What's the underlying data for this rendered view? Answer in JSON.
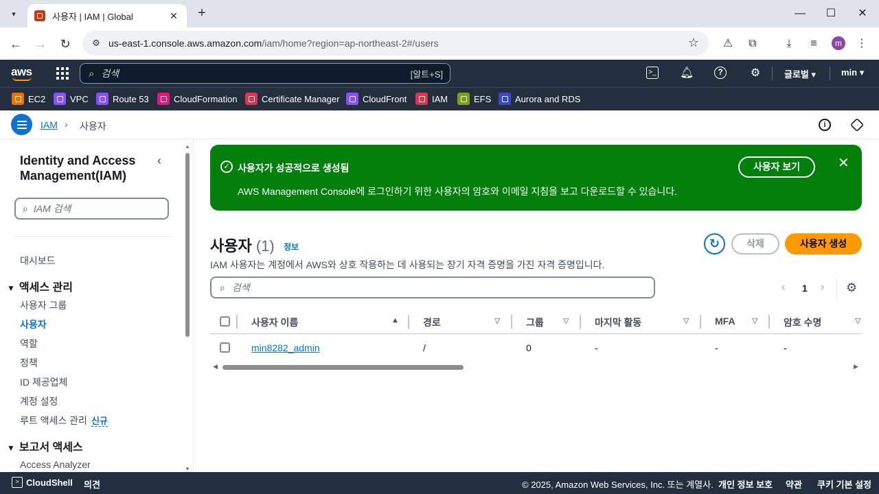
{
  "browser": {
    "tab_title": "사용자 | IAM | Global",
    "url_host": "us-east-1.console.aws.amazon.com",
    "url_path": "/iam/home?region=ap-northeast-2#/users",
    "profile_initial": "m"
  },
  "aws_nav": {
    "logo": "aws",
    "search_placeholder": "검색",
    "search_shortcut": "[알트+S]",
    "region": "글로벌 ▾",
    "user": "min ▾"
  },
  "favorites": [
    {
      "label": "EC2",
      "color": "#ed7100"
    },
    {
      "label": "VPC",
      "color": "#8c4fff"
    },
    {
      "label": "Route 53",
      "color": "#8c4fff"
    },
    {
      "label": "CloudFormation",
      "color": "#e7157b"
    },
    {
      "label": "Certificate Manager",
      "color": "#dd344c"
    },
    {
      "label": "CloudFront",
      "color": "#8c4fff"
    },
    {
      "label": "IAM",
      "color": "#dd344c"
    },
    {
      "label": "EFS",
      "color": "#7aa116"
    },
    {
      "label": "Aurora and RDS",
      "color": "#3b48cc"
    }
  ],
  "breadcrumb": {
    "root": "IAM",
    "current": "사용자"
  },
  "sidebar": {
    "title": "Identity and Access Management(IAM)",
    "search_placeholder": "IAM 검색",
    "dashboard": "대시보드",
    "section_access": "액세스 관리",
    "items": [
      "사용자 그룹",
      "사용자",
      "역할",
      "정책",
      "ID 제공업체",
      "계정 설정",
      "루트 액세스 관리"
    ],
    "new_badge": "신규",
    "section_reports": "보고서 액세스",
    "report_items": [
      "Access Analyzer"
    ]
  },
  "flash": {
    "title": "사용자가 성공적으로 생성됨",
    "message": "AWS Management Console에 로그인하기 위한 사용자의 암호와 이메일 지침을 보고 다운로드할 수 있습니다.",
    "button": "사용자 보기"
  },
  "header": {
    "title": "사용자",
    "count": "(1)",
    "info": "정보",
    "description": "IAM 사용자는 계정에서 AWS와 상호 작용하는 데 사용되는 장기 자격 증명을 가진 자격 증명입니다.",
    "delete": "삭제",
    "create": "사용자 생성"
  },
  "table": {
    "search_placeholder": "검색",
    "page": "1",
    "columns": [
      "사용자 이름",
      "경로",
      "그룹",
      "마지막 활동",
      "MFA",
      "암호 수명"
    ],
    "rows": [
      {
        "name": "min8282_admin",
        "path": "/",
        "groups": "0",
        "last_activity": "-",
        "mfa": "-",
        "password_age": "-"
      }
    ]
  },
  "footer": {
    "cloudshell": "CloudShell",
    "feedback": "의견",
    "copyright": "© 2025, Amazon Web Services, Inc. 또는 계열사.",
    "privacy": "개인 정보 보호",
    "terms": "약관",
    "cookies": "쿠키 기본 설정"
  }
}
